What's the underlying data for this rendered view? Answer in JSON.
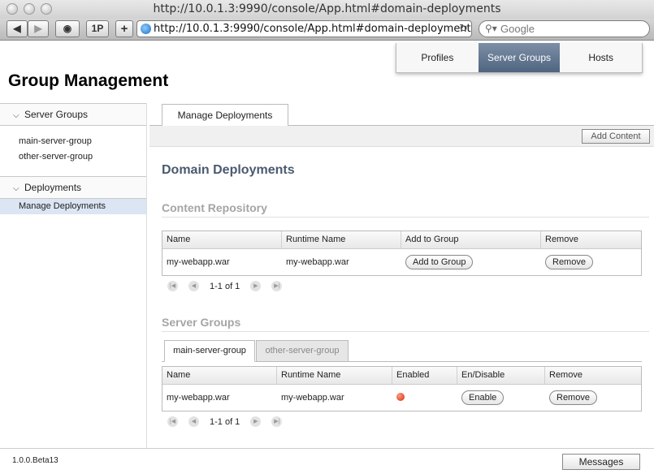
{
  "browser": {
    "window_title": "http://10.0.1.3:9990/console/App.html#domain-deployments",
    "address": "http://10.0.1.3:9990/console/App.html#domain-deployment",
    "search_placeholder": "Google",
    "onepassword_label": "1P",
    "add_label": "+"
  },
  "topnav": {
    "items": [
      {
        "label": "Profiles"
      },
      {
        "label": "Server Groups",
        "active": true
      },
      {
        "label": "Hosts"
      }
    ]
  },
  "page": {
    "title": "Group Management"
  },
  "sidebar": {
    "sections": [
      {
        "label": "Server Groups",
        "items": [
          "main-server-group",
          "other-server-group"
        ]
      },
      {
        "label": "Deployments",
        "items": [
          "Manage Deployments"
        ]
      }
    ]
  },
  "main": {
    "tab_label": "Manage Deployments",
    "add_content_label": "Add Content",
    "heading": "Domain Deployments",
    "repository": {
      "heading": "Content Repository",
      "columns": [
        "Name",
        "Runtime Name",
        "Add to Group",
        "Remove"
      ],
      "row": {
        "name": "my-webapp.war",
        "runtime_name": "my-webapp.war",
        "add_button": "Add to Group",
        "remove_button": "Remove"
      },
      "pager": "1-1 of 1"
    },
    "server_groups": {
      "heading": "Server Groups",
      "tabs": [
        "main-server-group",
        "other-server-group"
      ],
      "columns": [
        "Name",
        "Runtime Name",
        "Enabled",
        "En/Disable",
        "Remove"
      ],
      "row": {
        "name": "my-webapp.war",
        "runtime_name": "my-webapp.war",
        "enable_button": "Enable",
        "remove_button": "Remove",
        "enabled_color": "#d42a0c"
      },
      "pager": "1-1 of 1"
    }
  },
  "footer": {
    "version": "1.0.0.Beta13",
    "messages_label": "Messages"
  },
  "colors": {
    "active_tab": "#5d7290",
    "heading": "#4a5a70",
    "section_heading": "#a5a5a5",
    "selected_row": "#dbe5f3"
  }
}
